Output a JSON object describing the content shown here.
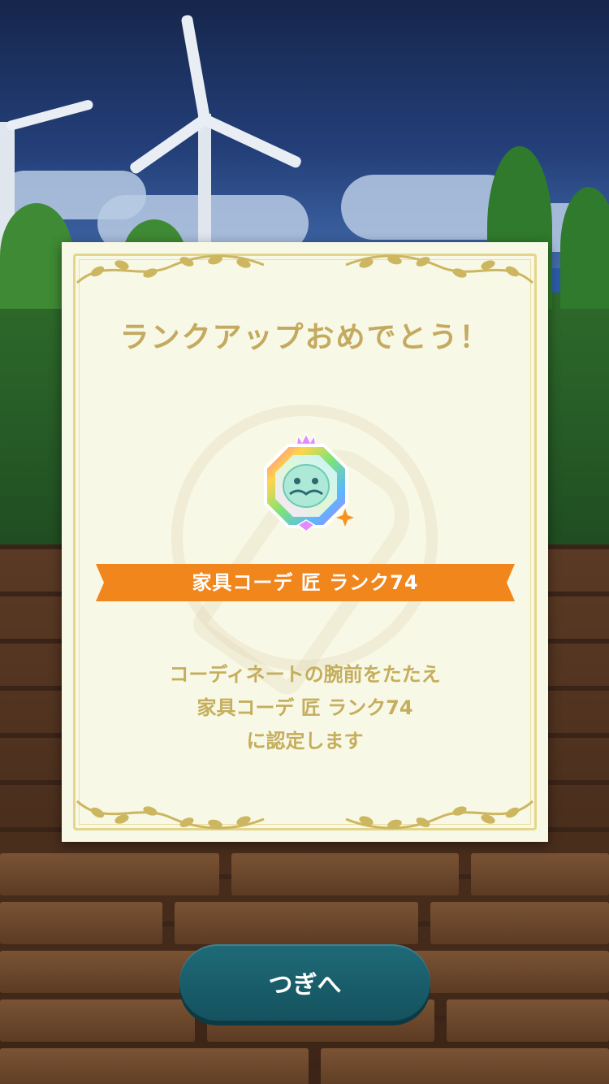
{
  "dialog": {
    "title": "ランクアップおめでとう！",
    "rank_banner": "家具コーデ 匠 ランク74",
    "message_lines": [
      "コーディネートの腕前をたたえ",
      "家具コーデ 匠 ランク74",
      "に認定します"
    ],
    "medal_icon": "rainbow-rank-medal-icon"
  },
  "next_button": {
    "label": "つぎへ"
  },
  "colors": {
    "dialog_bg": "#f8f8e6",
    "title_gold": "#c4aa5e",
    "banner_orange": "#f0861c",
    "button_teal": "#1a5f6b"
  }
}
